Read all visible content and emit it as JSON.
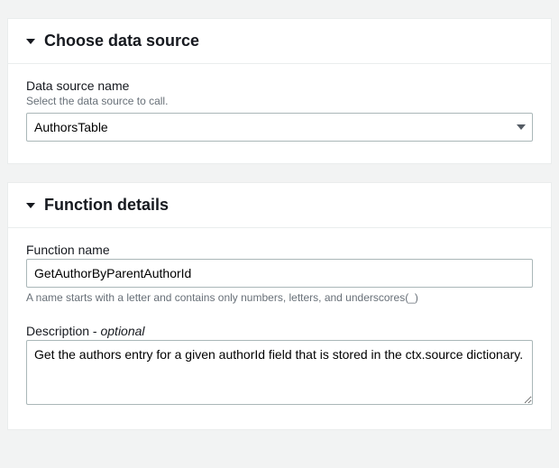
{
  "sections": {
    "dataSource": {
      "title": "Choose data source",
      "fieldLabel": "Data source name",
      "fieldHint": "Select the data source to call.",
      "selectedValue": "AuthorsTable"
    },
    "functionDetails": {
      "title": "Function details",
      "nameLabel": "Function name",
      "nameValue": "GetAuthorByParentAuthorId",
      "nameHint": "A name starts with a letter and contains only numbers, letters, and underscores(_)",
      "descLabel": "Description",
      "descOptional": "optional",
      "descDash": " - ",
      "descValue": "Get the authors entry for a given authorId field that is stored in the ctx.source dictionary."
    }
  }
}
